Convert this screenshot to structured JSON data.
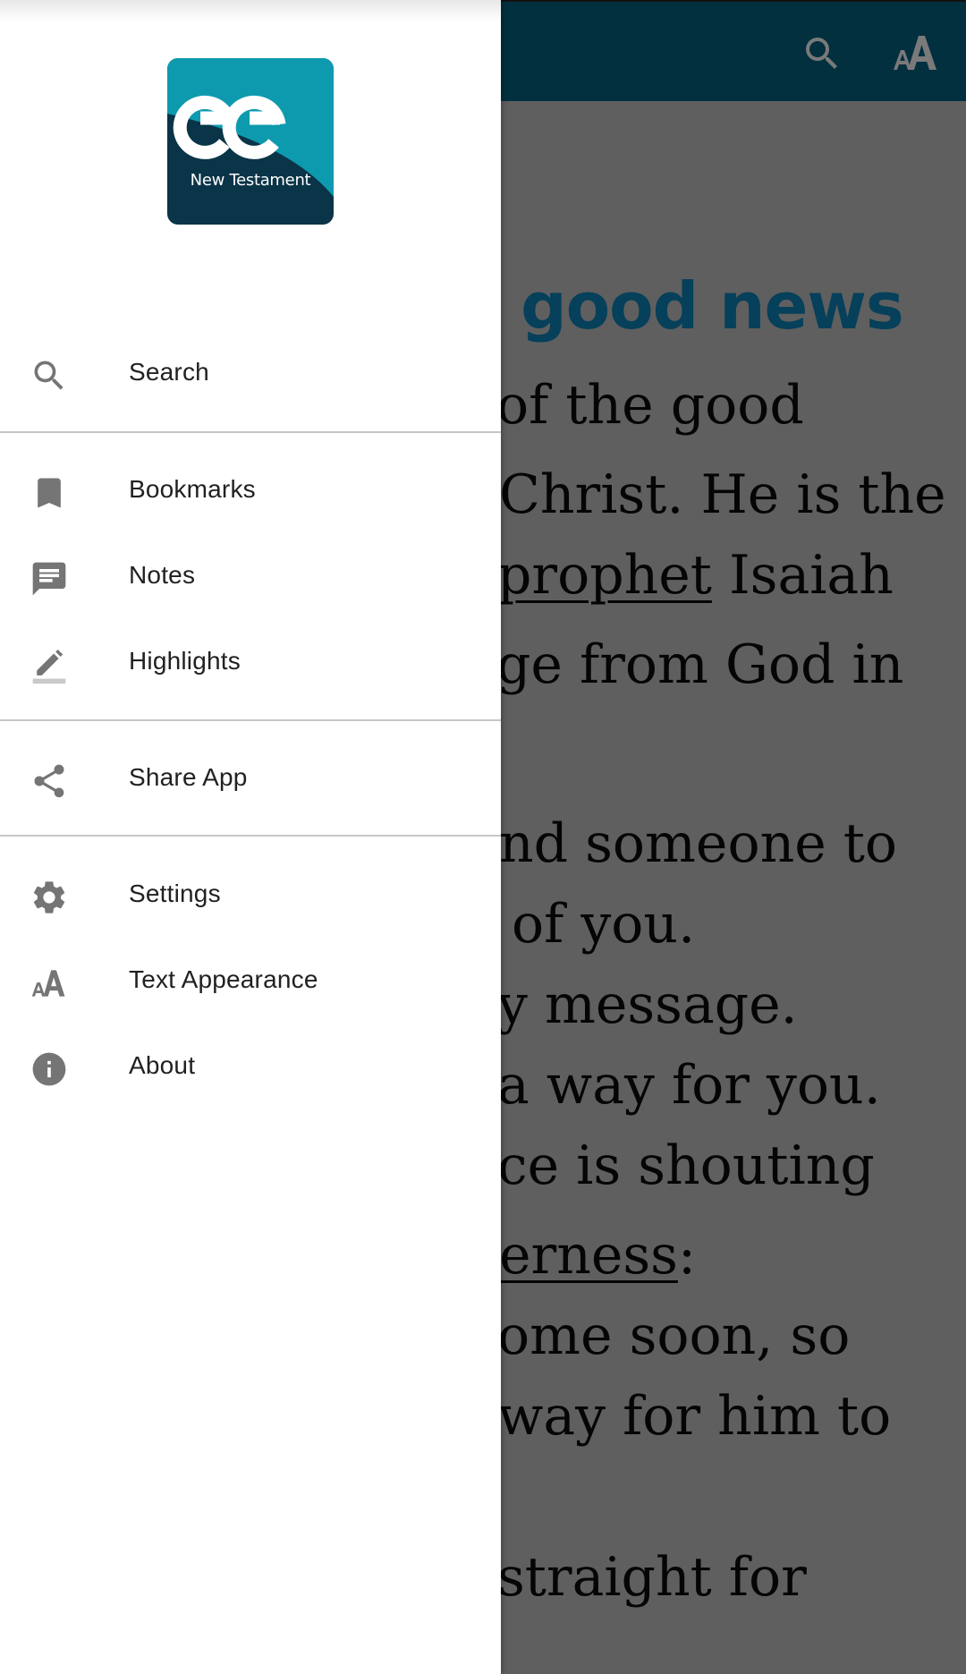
{
  "app_bar": {
    "background_color": "#03303f",
    "actions": [
      {
        "icon": "search-icon",
        "label": "Search"
      },
      {
        "icon": "text-size-icon",
        "label": "Text Appearance"
      }
    ]
  },
  "reader": {
    "heading": "ne good news",
    "heading_color": "#06405a",
    "lines": [
      {
        "text": "of the good",
        "underlined": ""
      },
      {
        "text": "Christ. He is the",
        "underlined": ""
      },
      {
        "text": " Isaiah",
        "underlined": "prophet"
      },
      {
        "text": "ge from God in",
        "underlined": ""
      },
      {
        "text": "nd someone to",
        "underlined": ""
      },
      {
        "text": " of you.",
        "underlined": ""
      },
      {
        "text": "y message.",
        "underlined": ""
      },
      {
        "text": "a way for you.",
        "underlined": ""
      },
      {
        "text": "ce is shouting",
        "underlined": ""
      },
      {
        "text": ":",
        "underlined": "erness"
      },
      {
        "text": "ome soon, so",
        "underlined": ""
      },
      {
        "text": "way for him to",
        "underlined": ""
      },
      {
        "text": "straight for",
        "underlined": ""
      }
    ]
  },
  "drawer": {
    "logo": {
      "mark": "ee",
      "caption": "New Testament",
      "colors": {
        "teal": "#0e9aae",
        "navy": "#0a3447"
      }
    },
    "sections": [
      {
        "items": [
          {
            "icon": "search-icon",
            "label": "Search"
          }
        ]
      },
      {
        "items": [
          {
            "icon": "bookmark-icon",
            "label": "Bookmarks"
          },
          {
            "icon": "notes-icon",
            "label": "Notes"
          },
          {
            "icon": "highlighter-icon",
            "label": "Highlights"
          }
        ]
      },
      {
        "items": [
          {
            "icon": "share-icon",
            "label": "Share App"
          }
        ]
      },
      {
        "items": [
          {
            "icon": "gear-icon",
            "label": "Settings"
          },
          {
            "icon": "text-size-icon",
            "label": "Text Appearance"
          },
          {
            "icon": "info-icon",
            "label": "About"
          }
        ]
      }
    ],
    "icon_color": "#757575",
    "label_color": "#212121"
  }
}
